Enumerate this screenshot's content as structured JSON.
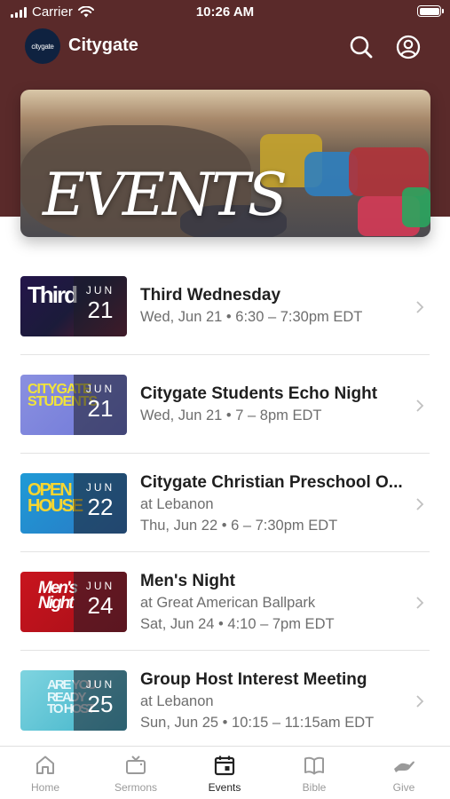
{
  "status_bar": {
    "carrier": "Carrier",
    "time": "10:26 AM"
  },
  "header": {
    "logo_text": "citygate",
    "title": "Citygate"
  },
  "hero": {
    "title": "EVENTS"
  },
  "events": [
    {
      "title": "Third Wednesday",
      "month": "JUN",
      "day": "21",
      "lines": [
        "Wed, Jun 21 • 6:30 – 7:30pm EDT"
      ],
      "art": "Third"
    },
    {
      "title": "Citygate Students Echo Night",
      "month": "JUN",
      "day": "21",
      "lines": [
        "Wed, Jun 21 • 7 – 8pm EDT"
      ],
      "art": "CITYGATE STUDENTS"
    },
    {
      "title": "Citygate Christian Preschool O...",
      "month": "JUN",
      "day": "22",
      "lines": [
        "at Lebanon",
        "Thu, Jun 22 • 6 – 7:30pm EDT"
      ],
      "art": "OPEN HOUSE"
    },
    {
      "title": "Men's Night",
      "month": "JUN",
      "day": "24",
      "lines": [
        "at Great American Ballpark",
        "Sat, Jun 24 • 4:10 – 7pm EDT"
      ],
      "art": "Men's Night"
    },
    {
      "title": "Group Host Interest Meeting",
      "month": "JUN",
      "day": "25",
      "lines": [
        "at Lebanon",
        "Sun, Jun 25 • 10:15 – 11:15am EDT"
      ],
      "art": "ARE YOU READY TO HOST"
    }
  ],
  "tabs": [
    {
      "label": "Home",
      "icon": "home-icon"
    },
    {
      "label": "Sermons",
      "icon": "tv-icon"
    },
    {
      "label": "Events",
      "icon": "calendar-icon",
      "active": true
    },
    {
      "label": "Bible",
      "icon": "book-icon"
    },
    {
      "label": "Give",
      "icon": "hand-icon"
    }
  ],
  "colors": {
    "header_bg": "#5a2a2a",
    "logo_bg": "#0f2240",
    "active_tab": "#222222",
    "inactive_tab": "#9a9a9a"
  }
}
